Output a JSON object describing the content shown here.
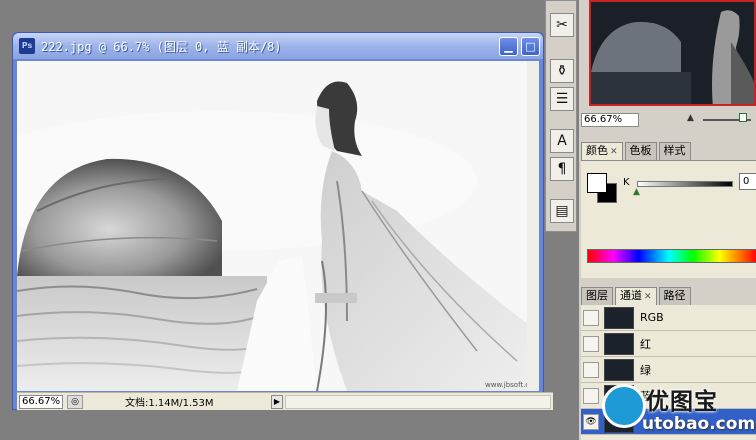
{
  "document": {
    "title": "222.jpg @ 66.7% (图层 0, 蓝 副本/8)",
    "zoom": "66.67%",
    "docinfo": "文档:1.14M/1.53M",
    "watermark_small": "www.jbsoft.com"
  },
  "navigator": {
    "zoom": "66.67%"
  },
  "color_panel": {
    "tabs": [
      "颜色",
      "色板",
      "样式"
    ],
    "active_tab": "颜色",
    "k_label": "K",
    "k_value": "0"
  },
  "channels_panel": {
    "tabs": [
      "图层",
      "通道",
      "路径"
    ],
    "active_tab": "通道",
    "channels": [
      "RGB",
      "红",
      "绿",
      "蓝"
    ]
  },
  "watermark": {
    "title": "优图宝",
    "url": "utobao.com"
  },
  "icons": {
    "titlebar_min": "minimize-icon",
    "titlebar_max": "maximize-icon",
    "tools": [
      "brush-tools-icon",
      "clone-stamp-icon",
      "history-icon",
      "character-icon",
      "paragraph-icon",
      "layer-comps-icon"
    ]
  }
}
